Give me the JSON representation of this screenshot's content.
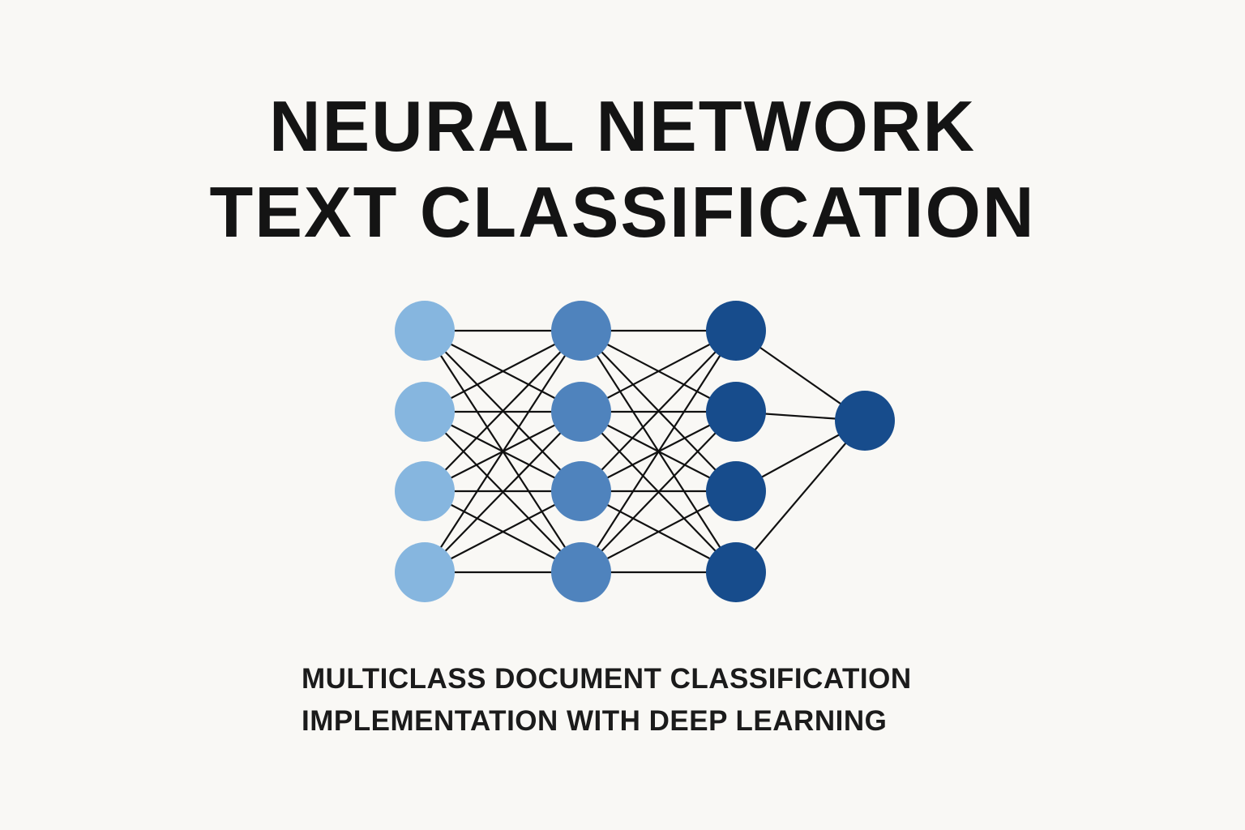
{
  "title": {
    "line1": "NEURAL NETWORK",
    "line2": "TEXT CLASSIFICATION"
  },
  "subtitle": {
    "line1": "MULTICLASS DOCUMENT CLASSIFICATION",
    "line2": "IMPLEMENTATION WITH DEEP LEARNING"
  },
  "network": {
    "layers": [
      {
        "nodes": 4,
        "color": "#86b6df"
      },
      {
        "nodes": 4,
        "color": "#4f83bd"
      },
      {
        "nodes": 4,
        "color": "#174c8c"
      },
      {
        "nodes": 1,
        "color": "#174c8c"
      }
    ],
    "edge_color": "#111111"
  }
}
